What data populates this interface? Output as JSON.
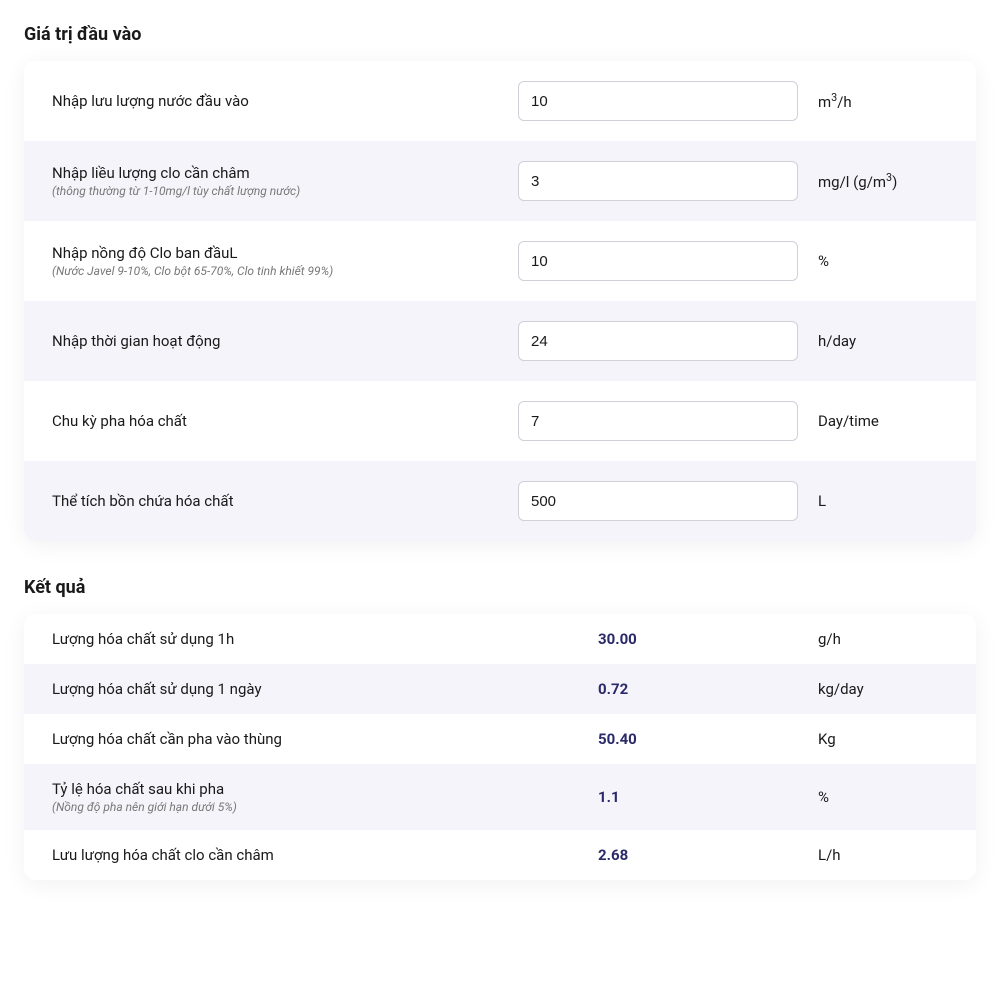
{
  "inputs": {
    "title": "Giá trị đầu vào",
    "rows": [
      {
        "label": "Nhập lưu lượng nước đầu vào",
        "sub": "",
        "value": "10",
        "unit_html": "m<sup>3</sup>/h"
      },
      {
        "label": "Nhập liều lượng clo cần châm",
        "sub": "(thông thường từ 1-10mg/l tùy chất lượng nước)",
        "value": "3",
        "unit_html": "mg/l (g/m<sup>3</sup>)"
      },
      {
        "label": "Nhập nồng độ Clo ban đầuL",
        "sub": "(Nước Javel 9-10%, Clo bột 65-70%, Clo tinh khiết 99%)",
        "value": "10",
        "unit_html": "%"
      },
      {
        "label": "Nhập thời gian hoạt động",
        "sub": "",
        "value": "24",
        "unit_html": "h/day"
      },
      {
        "label": "Chu kỳ pha hóa chất",
        "sub": "",
        "value": "7",
        "unit_html": "Day/time"
      },
      {
        "label": "Thể tích bồn chứa hóa chất",
        "sub": "",
        "value": "500",
        "unit_html": "L"
      }
    ]
  },
  "results": {
    "title": "Kết quả",
    "rows": [
      {
        "label": "Lượng hóa chất sử dụng 1h",
        "sub": "",
        "value": "30.00",
        "unit": "g/h"
      },
      {
        "label": "Lượng hóa chất sử dụng 1 ngày",
        "sub": "",
        "value": "0.72",
        "unit": "kg/day"
      },
      {
        "label": "Lượng hóa chất cần pha vào thùng",
        "sub": "",
        "value": "50.40",
        "unit": "Kg"
      },
      {
        "label": "Tỷ lệ hóa chất sau khi pha",
        "sub": "(Nồng độ pha nên giới hạn dưới 5%)",
        "value": "1.1",
        "unit": "%"
      },
      {
        "label": "Lưu lượng hóa chất clo cần châm",
        "sub": "",
        "value": "2.68",
        "unit": "L/h"
      }
    ]
  }
}
